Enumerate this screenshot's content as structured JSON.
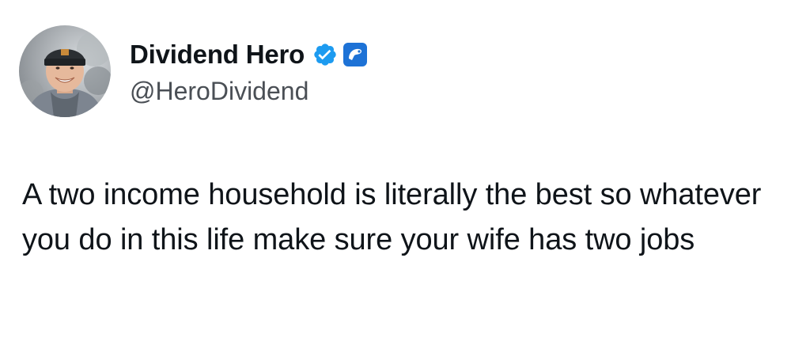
{
  "author": {
    "display_name": "Dividend Hero",
    "handle": "@HeroDividend",
    "verified_icon": "verified-badge-icon",
    "affiliate_icon": "affiliate-badge-icon",
    "verified_color": "#1d9bf0",
    "affiliate_color": "#1d72d6"
  },
  "tweet": {
    "text": "A two income household is literally the best so whatever you do in this life make sure your wife has two jobs"
  }
}
